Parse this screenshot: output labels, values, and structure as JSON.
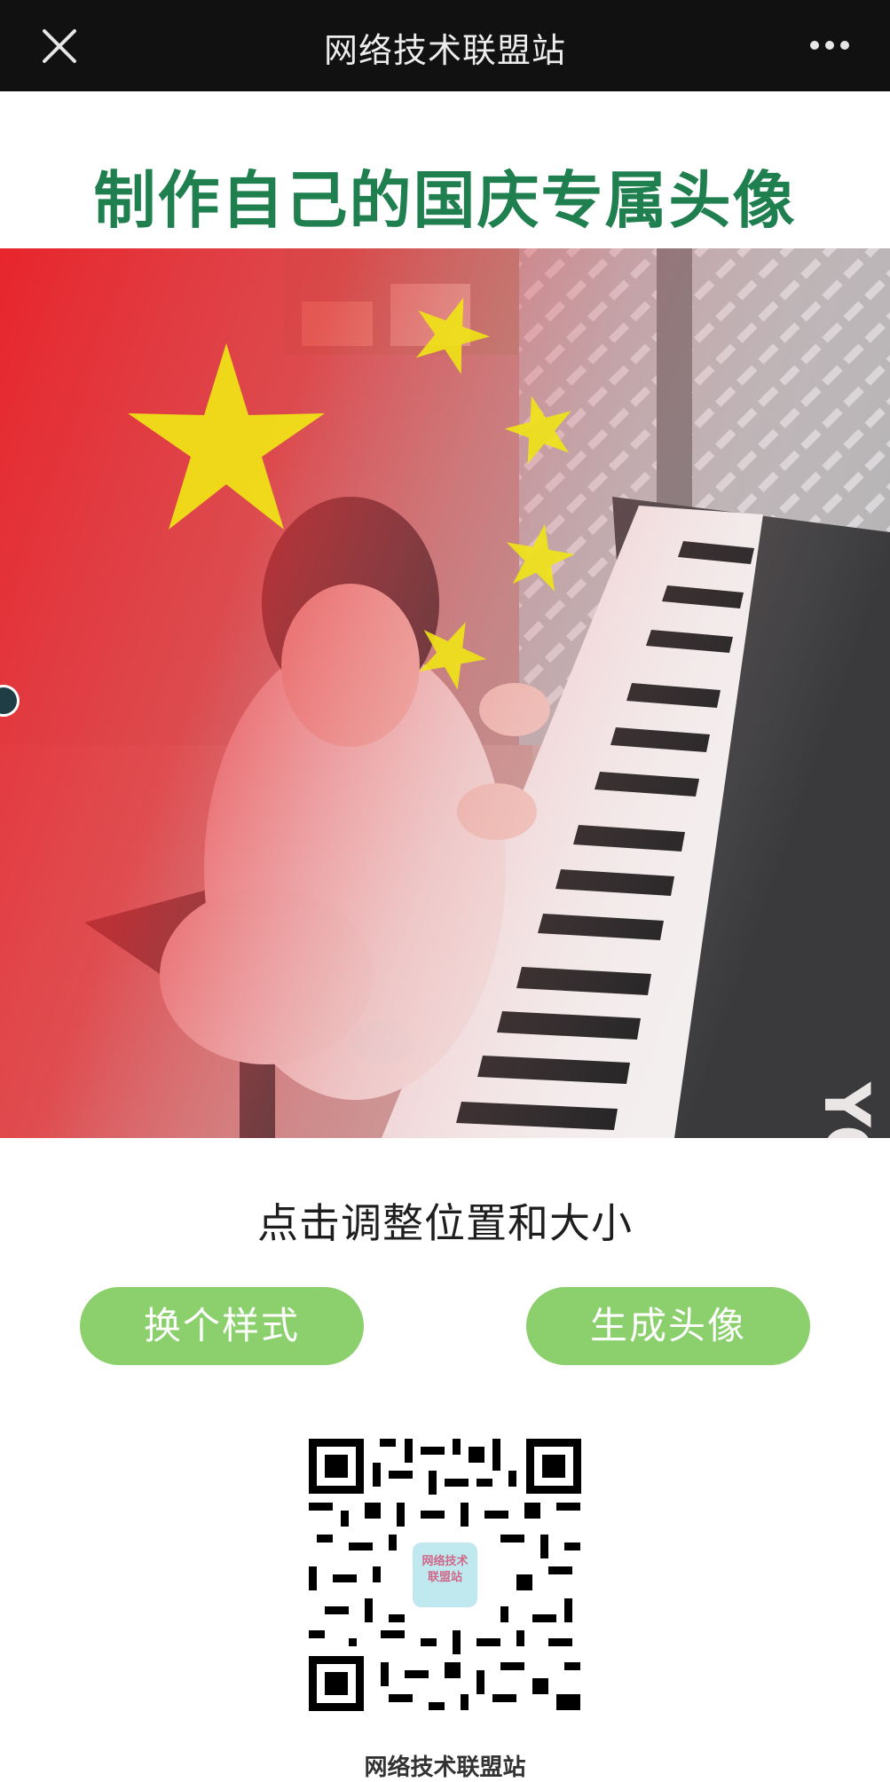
{
  "topbar": {
    "title": "网络技术联盟站",
    "close_icon": "close-icon",
    "more_icon": "more-icon"
  },
  "page": {
    "heading": "制作自己的国庆专属头像",
    "hint": "点击调整位置和大小",
    "buttons": {
      "change_style": "换个样式",
      "generate": "生成头像"
    },
    "qr": {
      "logo_line1": "网络技术",
      "logo_line2": "联盟站"
    },
    "footer_label": "网络技术联盟站"
  },
  "colors": {
    "heading": "#1f7f4e",
    "button": "#8bd06d",
    "flag_red": "#e8242a",
    "star_yellow": "#f0e516"
  }
}
